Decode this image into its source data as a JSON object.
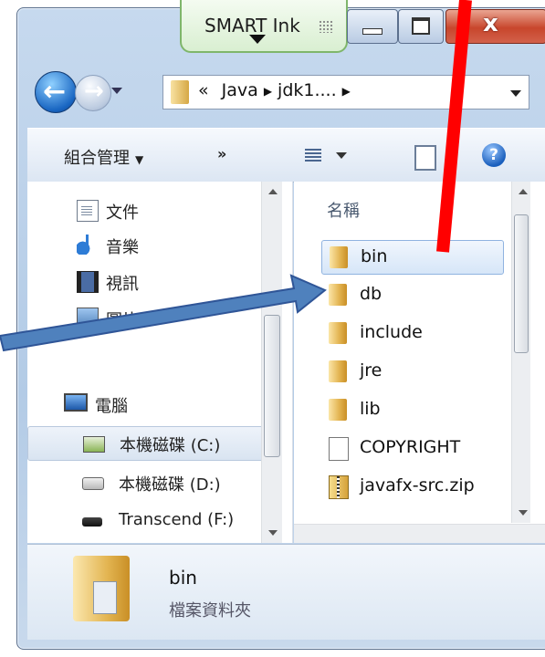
{
  "window": {
    "smart_ink_label": "SMART Ink",
    "close_glyph": "x"
  },
  "nav": {
    "breadcrumb_prefix": "«",
    "breadcrumbs": [
      "Java",
      "jdk1...."
    ]
  },
  "toolbar": {
    "organize_label": "組合管理",
    "more_label": "»"
  },
  "sidebar": {
    "items": [
      {
        "label": "文件",
        "icon": "document-icon"
      },
      {
        "label": "音樂",
        "icon": "music-icon"
      },
      {
        "label": "視訊",
        "icon": "video-icon"
      },
      {
        "label": "圖片",
        "icon": "picture-icon"
      },
      {
        "label": "電腦",
        "icon": "computer-icon"
      },
      {
        "label": "本機磁碟 (C:)",
        "icon": "drive-icon",
        "selected": true
      },
      {
        "label": "本機磁碟 (D:)",
        "icon": "drive-icon"
      },
      {
        "label": "Transcend (F:)",
        "icon": "usb-drive-icon"
      }
    ]
  },
  "files": {
    "column_header": "名稱",
    "items": [
      {
        "name": "bin",
        "type": "folder",
        "selected": true
      },
      {
        "name": "db",
        "type": "folder"
      },
      {
        "name": "include",
        "type": "folder"
      },
      {
        "name": "jre",
        "type": "folder"
      },
      {
        "name": "lib",
        "type": "folder"
      },
      {
        "name": "COPYRIGHT",
        "type": "file"
      },
      {
        "name": "javafx-src.zip",
        "type": "zip"
      }
    ]
  },
  "details": {
    "name": "bin",
    "type": "檔案資料夾"
  },
  "annotations": {
    "red_line_color": "#ff0000",
    "blue_arrow_color": "#4f81bd"
  }
}
